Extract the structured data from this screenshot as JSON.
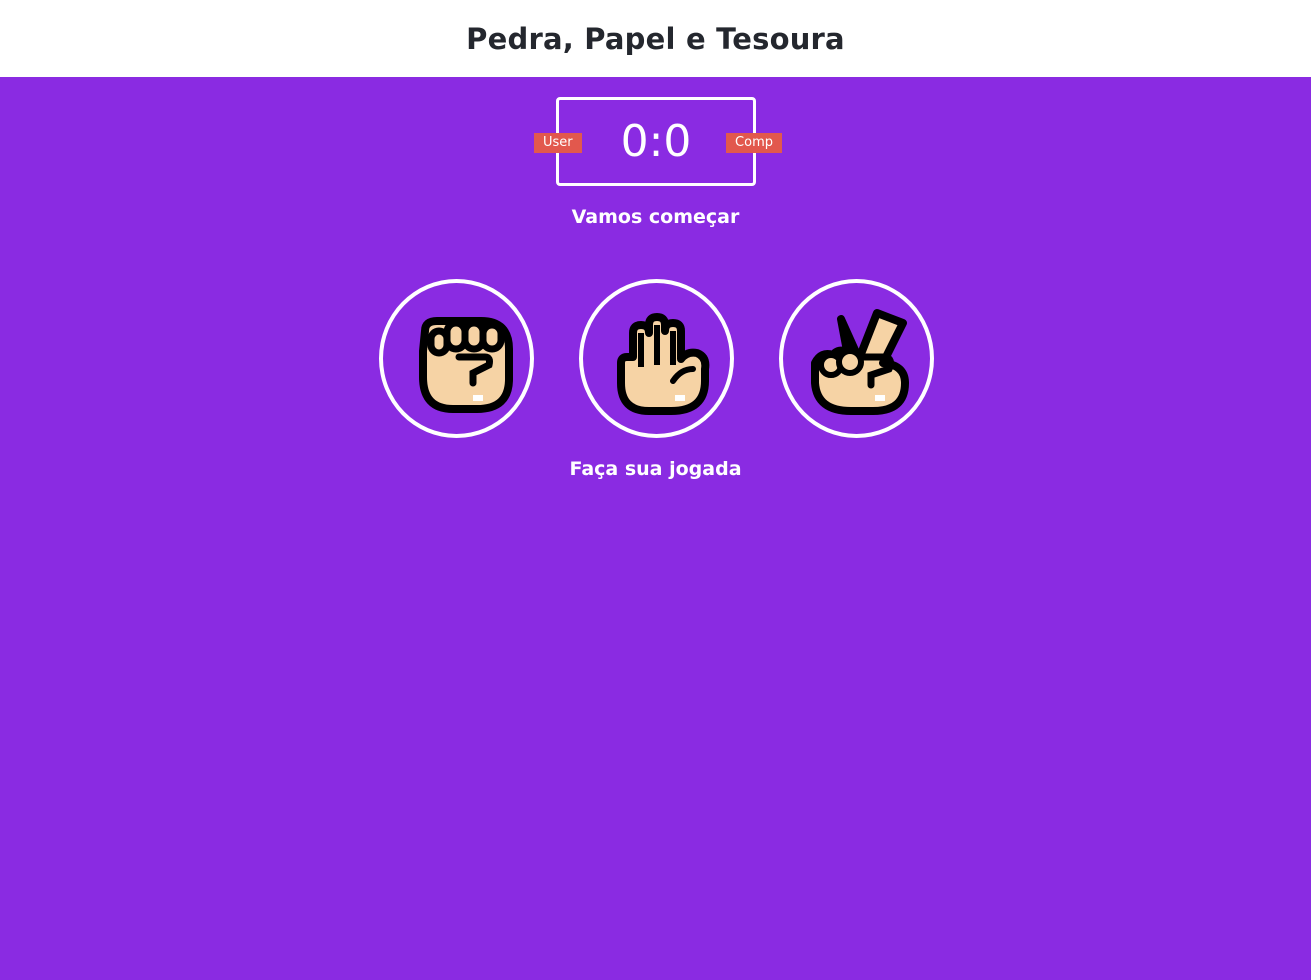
{
  "header": {
    "title": "Pedra, Papel e Tesoura"
  },
  "scoreboard": {
    "user_label": "User",
    "comp_label": "Comp",
    "score": "0:0"
  },
  "result": {
    "message": "Vamos começar"
  },
  "choices": [
    {
      "name": "rock",
      "icon": "fist-icon"
    },
    {
      "name": "paper",
      "icon": "raised-hand-icon"
    },
    {
      "name": "scissors",
      "icon": "victory-hand-icon"
    }
  ],
  "action": {
    "message": "Faça sua jogada"
  },
  "colors": {
    "background": "#8a2be2",
    "header": "#ffffff",
    "badge": "#e2584d",
    "skin": "#f6d3a5"
  }
}
